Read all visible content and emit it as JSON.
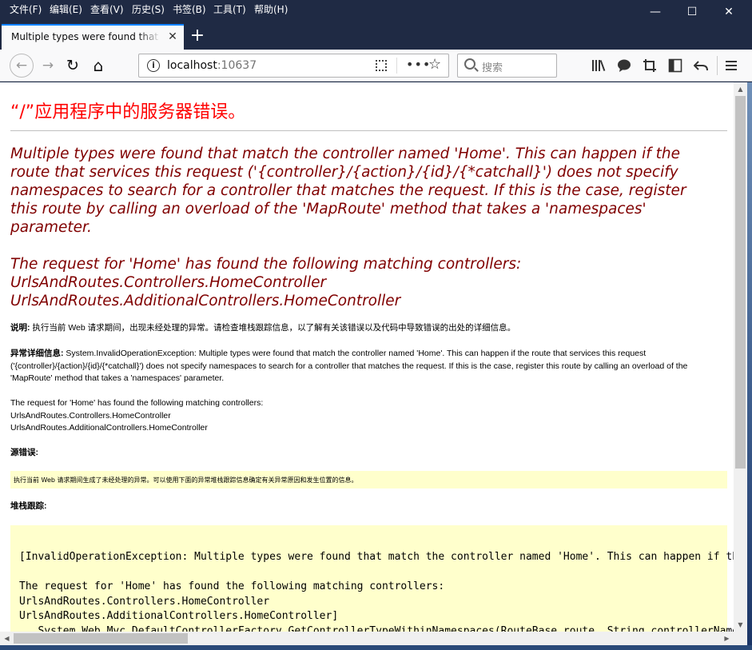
{
  "menu": [
    "文件(F)",
    "编辑(E)",
    "查看(V)",
    "历史(S)",
    "书签(B)",
    "工具(T)",
    "帮助(H)"
  ],
  "window_controls": {
    "minimize": "—",
    "maximize": "☐",
    "close": "✕"
  },
  "tab": {
    "title": "Multiple types were found that match the controller named 'Home'",
    "close": "✕",
    "new_tab": "+"
  },
  "nav": {
    "back": "←",
    "forward": "→",
    "reload": "↻",
    "home": "⌂",
    "url_host": "localhost",
    "url_port": ":10637",
    "search_placeholder": "搜索",
    "icons": [
      "library-icon",
      "chat-icon",
      "screenshot-icon",
      "reader-icon",
      "undo-icon",
      "menu-icon"
    ]
  },
  "page": {
    "heading": "“/”应用程序中的服务器错误。",
    "message_lines": [
      "Multiple types were found that match the controller named 'Home'. This can happen if the",
      "route that services this request ('{controller}/{action}/{id}/{*catchall}') does not specify",
      "namespaces to search for a controller that matches the request. If this is the case, register",
      "this route by calling an overload of the 'MapRoute' method that takes a 'namespaces'",
      "parameter."
    ],
    "message2_lines": [
      "The request for 'Home' has found the following matching controllers:",
      "UrlsAndRoutes.Controllers.HomeController",
      "UrlsAndRoutes.AdditionalControllers.HomeController"
    ],
    "desc_label": "说明:",
    "desc_text": " 执行当前 Web 请求期间，出现未经处理的异常。请检查堆栈跟踪信息，以了解有关该错误以及代码中导致错误的出处的详细信息。",
    "exc_label": "异常详细信息:",
    "exc_lines": [
      " System.InvalidOperationException: Multiple types were found that match the controller named 'Home'. This can happen if the route that services this request",
      "('{controller}/{action}/{id}/{*catchall}') does not specify namespaces to search for a controller that matches the request. If this is the case, register this route by calling an overload of the",
      "'MapRoute' method that takes a 'namespaces' parameter."
    ],
    "exc2_lines": [
      "The request for 'Home' has found the following matching controllers:",
      "UrlsAndRoutes.Controllers.HomeController",
      "UrlsAndRoutes.AdditionalControllers.HomeController"
    ],
    "source_label": "源错误:",
    "source_text": "执行当前 Web 请求期间生成了未经处理的异常。可以使用下面的异常堆栈跟踪信息确定有关异常原因和发生位置的信息。",
    "stack_label": "堆栈跟踪:",
    "stack_lines": [
      "[InvalidOperationException: Multiple types were found that match the controller named 'Home'. This can happen if the",
      "",
      "The request for 'Home' has found the following matching controllers:",
      "UrlsAndRoutes.Controllers.HomeController",
      "UrlsAndRoutes.AdditionalControllers.HomeController]",
      "   System.Web.Mvc.DefaultControllerFactory.GetControllerTypeWithinNamespaces(RouteBase route, String controllerName"
    ]
  },
  "colors": {
    "heading": "#ff0000",
    "message": "#800000",
    "highlight_box": "#ffffcc",
    "menubar": "#1f2a44",
    "tab_accent": "#0a84ff"
  }
}
